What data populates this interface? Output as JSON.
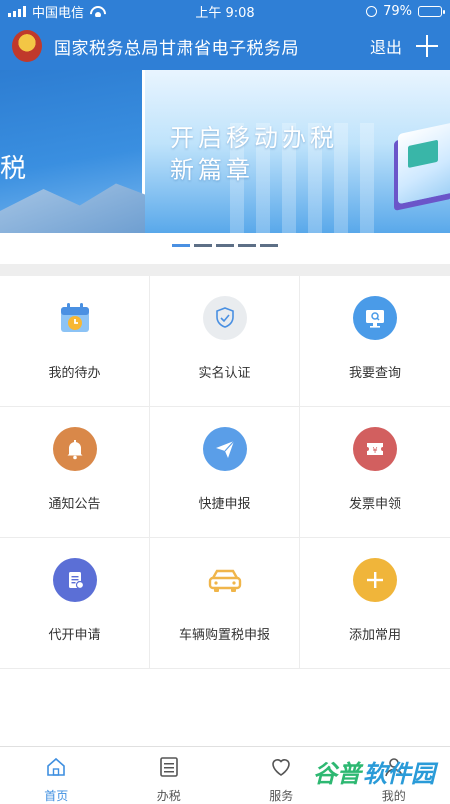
{
  "status_bar": {
    "carrier": "中国电信",
    "time": "上午 9:08",
    "battery": "79%",
    "battery_level": 0.79
  },
  "header": {
    "title": "国家税务总局甘肃省电子税务局",
    "logout_label": "退出"
  },
  "banner": {
    "title_line1": "开启移动办税",
    "title_line2": "新篇章",
    "left_fragment": "税",
    "active_index": 0,
    "page_count": 5
  },
  "grid": {
    "items": [
      {
        "label": "我的待办",
        "icon": "calendar-clock-icon",
        "color": "#5aa3ec"
      },
      {
        "label": "实名认证",
        "icon": "shield-check-icon",
        "color": "#e9ecef"
      },
      {
        "label": "我要查询",
        "icon": "monitor-search-icon",
        "color": "#4a9be8"
      },
      {
        "label": "通知公告",
        "icon": "bell-icon",
        "color": "#d98849"
      },
      {
        "label": "快捷申报",
        "icon": "paper-plane-icon",
        "color": "#5a9ee8"
      },
      {
        "label": "发票申领",
        "icon": "ticket-icon",
        "color": "#d25f5f"
      },
      {
        "label": "代开申请",
        "icon": "document-edit-icon",
        "color": "#5b6fd6"
      },
      {
        "label": "车辆购置税申报",
        "icon": "car-icon",
        "color": "#f0b54a"
      },
      {
        "label": "添加常用",
        "icon": "plus-icon",
        "color": "#f0b53a"
      }
    ]
  },
  "tabbar": {
    "tabs": [
      {
        "label": "首页",
        "icon": "home-icon",
        "active": true
      },
      {
        "label": "办税",
        "icon": "list-icon",
        "active": false
      },
      {
        "label": "服务",
        "icon": "heart-icon",
        "active": false
      },
      {
        "label": "我的",
        "icon": "user-icon",
        "active": false
      }
    ]
  },
  "watermark": {
    "part1": "谷普",
    "part2": "软件园"
  },
  "colors": {
    "brand_blue": "#2f7fd6",
    "active_tab": "#3f8fe0"
  }
}
